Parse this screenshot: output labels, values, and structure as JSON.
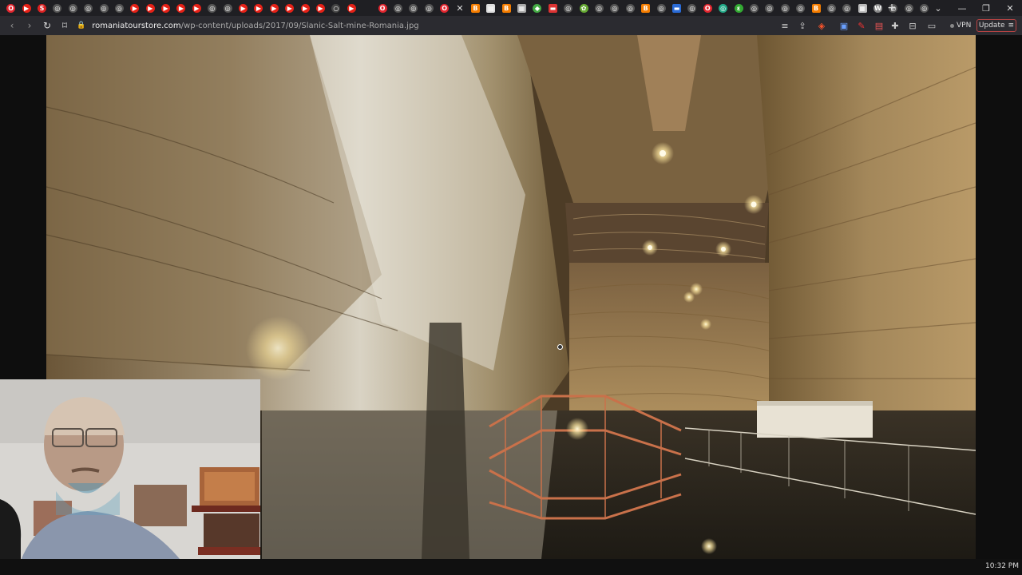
{
  "tabs": [
    {
      "icon": "opera-icon",
      "color": "#e3262f",
      "glyph": "O"
    },
    {
      "icon": "youtube-icon",
      "color": "#e62117",
      "glyph": "▶"
    },
    {
      "icon": "s-icon",
      "color": "#d22",
      "glyph": "S"
    },
    {
      "icon": "globe-icon",
      "color": "#555",
      "glyph": "◎"
    },
    {
      "icon": "globe-icon",
      "color": "#555",
      "glyph": "◎"
    },
    {
      "icon": "globe-icon",
      "color": "#555",
      "glyph": "◎"
    },
    {
      "icon": "globe-icon",
      "color": "#555",
      "glyph": "◎"
    },
    {
      "icon": "globe-icon",
      "color": "#555",
      "glyph": "◎"
    },
    {
      "icon": "youtube-icon",
      "color": "#e62117",
      "glyph": "▶"
    },
    {
      "icon": "youtube-icon",
      "color": "#e62117",
      "glyph": "▶"
    },
    {
      "icon": "youtube-icon",
      "color": "#e62117",
      "glyph": "▶"
    },
    {
      "icon": "youtube-icon",
      "color": "#e62117",
      "glyph": "▶"
    },
    {
      "icon": "youtube-icon",
      "color": "#e62117",
      "glyph": "▶"
    },
    {
      "icon": "globe-icon",
      "color": "#555",
      "glyph": "◎"
    },
    {
      "icon": "globe-icon",
      "color": "#555",
      "glyph": "◎"
    },
    {
      "icon": "youtube-icon",
      "color": "#e62117",
      "glyph": "▶"
    },
    {
      "icon": "youtube-icon",
      "color": "#e62117",
      "glyph": "▶"
    },
    {
      "icon": "youtube-icon",
      "color": "#e62117",
      "glyph": "▶"
    },
    {
      "icon": "youtube-icon",
      "color": "#e62117",
      "glyph": "▶"
    },
    {
      "icon": "youtube-icon",
      "color": "#e62117",
      "glyph": "▶"
    },
    {
      "icon": "youtube-icon",
      "color": "#e62117",
      "glyph": "▶"
    },
    {
      "icon": "loading-icon",
      "color": "#444",
      "glyph": "○"
    },
    {
      "icon": "youtube-icon",
      "color": "#e62117",
      "glyph": "▶"
    },
    {
      "icon": "spacer",
      "color": "transparent",
      "glyph": ""
    },
    {
      "icon": "opera-icon",
      "color": "#e3262f",
      "glyph": "O"
    },
    {
      "icon": "globe-icon",
      "color": "#555",
      "glyph": "◎"
    },
    {
      "icon": "globe-icon",
      "color": "#555",
      "glyph": "◎"
    },
    {
      "icon": "globe-icon",
      "color": "#555",
      "glyph": "◎"
    },
    {
      "icon": "opera-icon",
      "color": "#e3262f",
      "glyph": "O"
    },
    {
      "icon": "close-icon",
      "color": "transparent",
      "glyph": "✕",
      "active": true
    },
    {
      "icon": "blogger-icon",
      "color": "#f57d00",
      "glyph": "B",
      "square": true
    },
    {
      "icon": "document-icon",
      "color": "#ddd",
      "glyph": "▤",
      "square": true
    },
    {
      "icon": "blogger-icon",
      "color": "#f57d00",
      "glyph": "B",
      "square": true
    },
    {
      "icon": "image-icon",
      "color": "#aaa",
      "glyph": "▦",
      "square": true
    },
    {
      "icon": "map-icon",
      "color": "#4a4",
      "glyph": "◆"
    },
    {
      "icon": "flag-icon",
      "color": "#d33",
      "glyph": "▬",
      "square": true
    },
    {
      "icon": "globe-icon",
      "color": "#555",
      "glyph": "◎"
    },
    {
      "icon": "puzzle-icon",
      "color": "#6a3",
      "glyph": "✿"
    },
    {
      "icon": "globe-icon",
      "color": "#555",
      "glyph": "◎"
    },
    {
      "icon": "globe-icon",
      "color": "#555",
      "glyph": "◎"
    },
    {
      "icon": "globe-icon",
      "color": "#555",
      "glyph": "◎"
    },
    {
      "icon": "blogger-icon",
      "color": "#f57d00",
      "glyph": "B",
      "square": true
    },
    {
      "icon": "globe-icon",
      "color": "#555",
      "glyph": "◎"
    },
    {
      "icon": "ukraine-flag-icon",
      "color": "#2a6bd6",
      "glyph": "▬",
      "square": true
    },
    {
      "icon": "globe-icon",
      "color": "#555",
      "glyph": "◎"
    },
    {
      "icon": "opera-icon",
      "color": "#e3262f",
      "glyph": "O"
    },
    {
      "icon": "globe-icon",
      "color": "#2a8",
      "glyph": "◎"
    },
    {
      "icon": "leaf-icon",
      "color": "#3a3",
      "glyph": "ε"
    },
    {
      "icon": "globe-icon",
      "color": "#555",
      "glyph": "◎"
    },
    {
      "icon": "globe-icon",
      "color": "#555",
      "glyph": "◎"
    },
    {
      "icon": "globe-icon",
      "color": "#555",
      "glyph": "◎"
    },
    {
      "icon": "globe-icon",
      "color": "#555",
      "glyph": "◎"
    },
    {
      "icon": "blogger-icon",
      "color": "#f57d00",
      "glyph": "B",
      "square": true
    },
    {
      "icon": "globe-icon",
      "color": "#555",
      "glyph": "◎"
    },
    {
      "icon": "globe-icon",
      "color": "#555",
      "glyph": "◎"
    },
    {
      "icon": "image-icon",
      "color": "#bbb",
      "glyph": "▦",
      "square": true
    },
    {
      "icon": "wordpress-icon",
      "color": "#888",
      "glyph": "W"
    },
    {
      "icon": "globe-icon",
      "color": "#555",
      "glyph": "◎"
    },
    {
      "icon": "globe-icon",
      "color": "#555",
      "glyph": "◎"
    },
    {
      "icon": "globe-icon",
      "color": "#555",
      "glyph": "◎"
    }
  ],
  "newtab_glyph": "+",
  "window": {
    "tabmenu": "⌄",
    "minimize": "—",
    "restore": "❐",
    "close": "✕"
  },
  "nav": {
    "back": "‹",
    "forward": "›",
    "reload": "↻",
    "bookmark": "⌑"
  },
  "address": {
    "lock": "🔒",
    "host": "romaniatourstore.com",
    "path": "/wp-content/uploads/2017/09/Slanic-Salt-mine-Romania.jpg"
  },
  "toolbar_icons": {
    "menu": "≡",
    "share": "⇪",
    "shield": "◈",
    "ext1": "▣",
    "ext2": "✎",
    "ext3": "▤",
    "puzzle": "✚",
    "sidebar": "▭"
  },
  "vpn_label": "VPN",
  "update_label": "Update",
  "update_menu": "≡",
  "clock": "10:32 PM",
  "colors": {
    "tabstrip": "#1f1f23",
    "toolbar": "#2b2b30",
    "salt_wall": "#a88a5a",
    "bridge": "#c9714a",
    "brave_orange": "#fb542b"
  }
}
